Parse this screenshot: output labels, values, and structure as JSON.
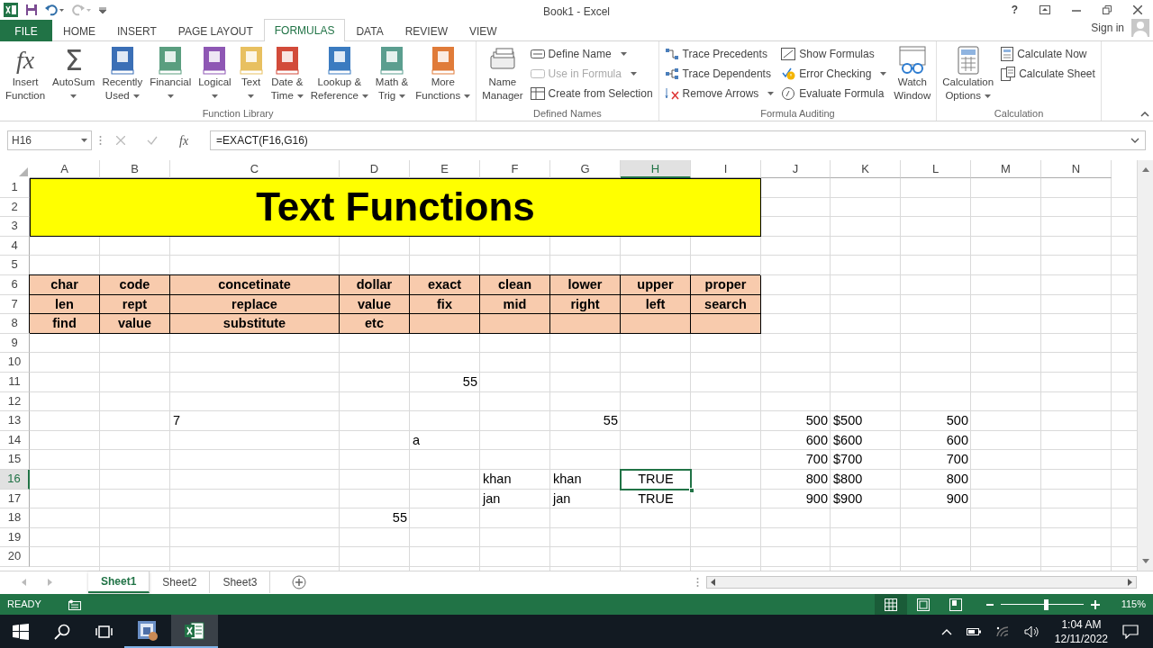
{
  "title_bar": {
    "title": "Book1 - Excel",
    "help": "?"
  },
  "ribbon": {
    "tabs": [
      {
        "label": "FILE",
        "kind": "file",
        "selected": false
      },
      {
        "label": "HOME",
        "kind": "tab",
        "selected": false
      },
      {
        "label": "INSERT",
        "kind": "tab",
        "selected": false
      },
      {
        "label": "PAGE LAYOUT",
        "kind": "tab",
        "selected": false
      },
      {
        "label": "FORMULAS",
        "kind": "tab",
        "selected": true
      },
      {
        "label": "DATA",
        "kind": "tab",
        "selected": false
      },
      {
        "label": "REVIEW",
        "kind": "tab",
        "selected": false
      },
      {
        "label": "VIEW",
        "kind": "tab",
        "selected": false
      }
    ],
    "account": "Sign in",
    "groups": [
      {
        "label": "Function Library",
        "items": [
          {
            "kind": "large",
            "glyph": "fx",
            "lines": [
              "Insert",
              "Function"
            ],
            "dropdown": false
          },
          {
            "kind": "large",
            "glyph": "Σ",
            "lines": [
              "AutoSum"
            ],
            "dropdown": true
          },
          {
            "kind": "large",
            "lines": [
              "Recently",
              "Used"
            ],
            "dropdown": true
          },
          {
            "kind": "large",
            "lines": [
              "Financial"
            ],
            "dropdown": true
          },
          {
            "kind": "large",
            "lines": [
              "Logical"
            ],
            "dropdown": true
          },
          {
            "kind": "large",
            "lines": [
              "Text"
            ],
            "dropdown": true
          },
          {
            "kind": "large",
            "lines": [
              "Date &",
              "Time"
            ],
            "dropdown": true
          },
          {
            "kind": "large",
            "lines": [
              "Lookup &",
              "Reference"
            ],
            "dropdown": true
          },
          {
            "kind": "large",
            "lines": [
              "Math &",
              "Trig"
            ],
            "dropdown": true
          },
          {
            "kind": "large",
            "lines": [
              "More",
              "Functions"
            ],
            "dropdown": true
          }
        ]
      },
      {
        "label": "Defined Names",
        "items": [
          {
            "kind": "large",
            "lines": [
              "Name",
              "Manager"
            ],
            "dropdown": false
          },
          {
            "kind": "small",
            "label": "Define Name",
            "dropdown": true,
            "disabled": false
          },
          {
            "kind": "small",
            "label": "Use in Formula",
            "dropdown": true,
            "disabled": true
          },
          {
            "kind": "small",
            "label": "Create from Selection",
            "dropdown": false,
            "disabled": false
          }
        ]
      },
      {
        "label": "Formula Auditing",
        "items": [
          {
            "kind": "small",
            "label": "Trace Precedents",
            "dropdown": false,
            "disabled": false
          },
          {
            "kind": "small",
            "label": "Trace Dependents",
            "dropdown": false,
            "disabled": false
          },
          {
            "kind": "small",
            "label": "Remove Arrows",
            "dropdown": true,
            "disabled": false
          },
          {
            "kind": "small",
            "label": "Show Formulas",
            "dropdown": false,
            "disabled": false
          },
          {
            "kind": "small",
            "label": "Error Checking",
            "dropdown": true,
            "disabled": false
          },
          {
            "kind": "small",
            "label": "Evaluate Formula",
            "dropdown": false,
            "disabled": false
          },
          {
            "kind": "large",
            "lines": [
              "Watch",
              "Window"
            ],
            "dropdown": false
          }
        ]
      },
      {
        "label": "Calculation",
        "items": [
          {
            "kind": "large",
            "lines": [
              "Calculation",
              "Options"
            ],
            "dropdown": true
          },
          {
            "kind": "small",
            "label": "Calculate Now",
            "dropdown": false,
            "disabled": false
          },
          {
            "kind": "small",
            "label": "Calculate Sheet",
            "dropdown": false,
            "disabled": false
          }
        ]
      }
    ]
  },
  "formula_bar": {
    "name_box": "H16",
    "function_button": "fx",
    "formula": "=EXACT(F16,G16)"
  },
  "banner": {
    "text": "Text Functions"
  },
  "sheet": {
    "columns": [
      {
        "label": "A",
        "selected": false
      },
      {
        "label": "B",
        "selected": false
      },
      {
        "label": "C",
        "selected": false
      },
      {
        "label": "D",
        "selected": false
      },
      {
        "label": "E",
        "selected": false
      },
      {
        "label": "F",
        "selected": false
      },
      {
        "label": "G",
        "selected": false
      },
      {
        "label": "H",
        "selected": true
      },
      {
        "label": "I",
        "selected": false
      },
      {
        "label": "J",
        "selected": false
      },
      {
        "label": "K",
        "selected": false
      },
      {
        "label": "L",
        "selected": false
      },
      {
        "label": "M",
        "selected": false
      },
      {
        "label": "N",
        "selected": false
      }
    ],
    "rows": [
      {
        "number": "1",
        "selected": false,
        "cells": [
          null,
          null,
          null,
          null,
          null,
          null,
          null,
          null,
          null,
          null,
          null,
          null,
          null,
          null
        ]
      },
      {
        "number": "2",
        "selected": false,
        "cells": [
          null,
          null,
          null,
          null,
          null,
          null,
          null,
          null,
          null,
          null,
          null,
          null,
          null,
          null
        ]
      },
      {
        "number": "3",
        "selected": false,
        "cells": [
          null,
          null,
          null,
          null,
          null,
          null,
          null,
          null,
          null,
          null,
          null,
          null,
          null,
          null
        ]
      },
      {
        "number": "4",
        "selected": false,
        "cells": [
          null,
          null,
          null,
          null,
          null,
          null,
          null,
          null,
          null,
          null,
          null,
          null,
          null,
          null
        ]
      },
      {
        "number": "5",
        "selected": false,
        "cells": [
          null,
          null,
          null,
          null,
          null,
          null,
          null,
          null,
          null,
          null,
          null,
          null,
          null,
          null
        ]
      },
      {
        "number": "6",
        "selected": false,
        "cells": [
          {
            "kind": "header",
            "text": "char",
            "selected": false
          },
          {
            "kind": "header",
            "text": "code",
            "selected": false
          },
          {
            "kind": "header",
            "text": "concetinate",
            "selected": false
          },
          {
            "kind": "header",
            "text": "dollar",
            "selected": false
          },
          {
            "kind": "header",
            "text": "exact",
            "selected": false
          },
          {
            "kind": "header",
            "text": "clean",
            "selected": false
          },
          {
            "kind": "header",
            "text": "lower",
            "selected": false
          },
          {
            "kind": "header",
            "text": "upper",
            "selected": false
          },
          {
            "kind": "header",
            "text": "proper",
            "selected": false
          },
          null,
          null,
          null,
          null,
          null
        ]
      },
      {
        "number": "7",
        "selected": false,
        "cells": [
          {
            "kind": "header",
            "text": "len",
            "selected": false
          },
          {
            "kind": "header",
            "text": "rept",
            "selected": false
          },
          {
            "kind": "header",
            "text": "replace",
            "selected": false
          },
          {
            "kind": "header",
            "text": "value",
            "selected": false
          },
          {
            "kind": "header",
            "text": "fix",
            "selected": false
          },
          {
            "kind": "header",
            "text": "mid",
            "selected": false
          },
          {
            "kind": "header",
            "text": "right",
            "selected": false
          },
          {
            "kind": "header",
            "text": "left",
            "selected": false
          },
          {
            "kind": "header",
            "text": "search",
            "selected": false
          },
          null,
          null,
          null,
          null,
          null
        ]
      },
      {
        "number": "8",
        "selected": false,
        "cells": [
          {
            "kind": "header",
            "text": "find",
            "selected": false
          },
          {
            "kind": "header",
            "text": "value",
            "selected": false
          },
          {
            "kind": "header",
            "text": "substitute",
            "selected": false
          },
          {
            "kind": "header",
            "text": "etc",
            "selected": false
          },
          {
            "kind": "header",
            "selected": false
          },
          {
            "kind": "header",
            "selected": false
          },
          {
            "kind": "header",
            "selected": false
          },
          {
            "kind": "header",
            "selected": false
          },
          {
            "kind": "header",
            "selected": false
          },
          null,
          null,
          null,
          null,
          null
        ]
      },
      {
        "number": "9",
        "selected": false,
        "cells": [
          null,
          null,
          null,
          null,
          null,
          null,
          null,
          null,
          null,
          null,
          null,
          null,
          null,
          null
        ]
      },
      {
        "number": "10",
        "selected": false,
        "cells": [
          null,
          null,
          null,
          null,
          null,
          null,
          null,
          null,
          null,
          null,
          null,
          null,
          null,
          null
        ]
      },
      {
        "number": "11",
        "selected": false,
        "cells": [
          null,
          null,
          null,
          null,
          {
            "kind": "number",
            "text": "55",
            "selected": false
          },
          null,
          null,
          null,
          null,
          null,
          null,
          null,
          null,
          null
        ]
      },
      {
        "number": "12",
        "selected": false,
        "cells": [
          null,
          null,
          null,
          null,
          null,
          null,
          null,
          null,
          null,
          null,
          null,
          null,
          null,
          null
        ]
      },
      {
        "number": "13",
        "selected": false,
        "cells": [
          null,
          null,
          {
            "kind": "label",
            "text": "7",
            "selected": false
          },
          null,
          null,
          null,
          {
            "kind": "number",
            "text": "55",
            "selected": false
          },
          null,
          null,
          {
            "kind": "number",
            "text": "500",
            "selected": false
          },
          {
            "kind": "label",
            "text": "$500",
            "selected": false
          },
          {
            "kind": "number",
            "text": "500",
            "selected": false
          },
          null,
          null
        ]
      },
      {
        "number": "14",
        "selected": false,
        "cells": [
          null,
          null,
          null,
          null,
          {
            "kind": "label",
            "text": "a",
            "selected": false
          },
          null,
          null,
          null,
          null,
          {
            "kind": "number",
            "text": "600",
            "selected": false
          },
          {
            "kind": "label",
            "text": "$600",
            "selected": false
          },
          {
            "kind": "number",
            "text": "600",
            "selected": false
          },
          null,
          null
        ]
      },
      {
        "number": "15",
        "selected": false,
        "cells": [
          null,
          null,
          null,
          null,
          null,
          null,
          null,
          null,
          null,
          {
            "kind": "number",
            "text": "700",
            "selected": false
          },
          {
            "kind": "label",
            "text": "$700",
            "selected": false
          },
          {
            "kind": "number",
            "text": "700",
            "selected": false
          },
          null,
          null
        ]
      },
      {
        "number": "16",
        "selected": true,
        "cells": [
          null,
          null,
          null,
          null,
          null,
          {
            "kind": "label",
            "text": "khan",
            "selected": false
          },
          {
            "kind": "label",
            "text": "khan",
            "selected": false
          },
          {
            "kind": "logical",
            "text": "TRUE",
            "selected": true
          },
          null,
          {
            "kind": "number",
            "text": "800",
            "selected": false
          },
          {
            "kind": "label",
            "text": "$800",
            "selected": false
          },
          {
            "kind": "number",
            "text": "800",
            "selected": false
          },
          null,
          null
        ]
      },
      {
        "number": "17",
        "selected": false,
        "cells": [
          null,
          null,
          null,
          null,
          null,
          {
            "kind": "label",
            "text": "jan",
            "selected": false
          },
          {
            "kind": "label",
            "text": "jan",
            "selected": false
          },
          {
            "kind": "logical",
            "text": "TRUE",
            "selected": false
          },
          null,
          {
            "kind": "number",
            "text": "900",
            "selected": false
          },
          {
            "kind": "label",
            "text": "$900",
            "selected": false
          },
          {
            "kind": "number",
            "text": "900",
            "selected": false
          },
          null,
          null
        ]
      },
      {
        "number": "18",
        "selected": false,
        "cells": [
          null,
          null,
          null,
          {
            "kind": "number",
            "text": "55",
            "selected": false
          },
          null,
          null,
          null,
          null,
          null,
          null,
          null,
          null,
          null,
          null
        ]
      },
      {
        "number": "19",
        "selected": false,
        "cells": [
          null,
          null,
          null,
          null,
          null,
          null,
          null,
          null,
          null,
          null,
          null,
          null,
          null,
          null
        ]
      },
      {
        "number": "20",
        "selected": false,
        "cells": [
          null,
          null,
          null,
          null,
          null,
          null,
          null,
          null,
          null,
          null,
          null,
          null,
          null,
          null
        ]
      }
    ]
  },
  "sheet_tabs": [
    {
      "label": "Sheet1",
      "selected": true
    },
    {
      "label": "Sheet2",
      "selected": false
    },
    {
      "label": "Sheet3",
      "selected": false
    }
  ],
  "status_bar": {
    "mode": "READY",
    "views": [
      {
        "selected": true
      },
      {
        "selected": false
      },
      {
        "selected": false
      }
    ],
    "zoom": {
      "level": 0.55,
      "reading": "115%"
    }
  },
  "taskbar": {
    "apps": [
      {
        "active": false
      },
      {
        "active": true
      }
    ],
    "time": "1:04 AM",
    "date": "12/11/2022"
  }
}
